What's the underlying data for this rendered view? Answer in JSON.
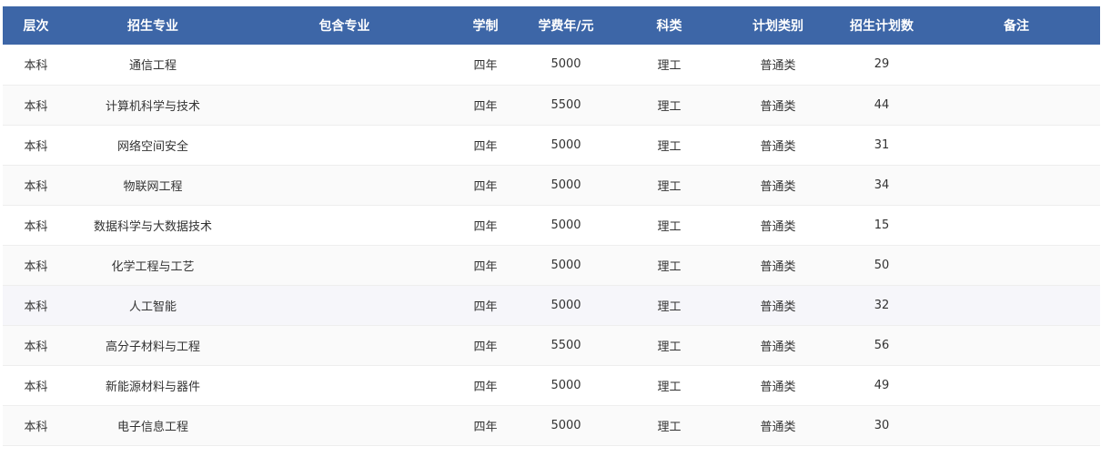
{
  "table": {
    "headers": {
      "level": "层次",
      "major": "招生专业",
      "include": "包含专业",
      "years": "学制",
      "fee": "学费年/元",
      "category": "科类",
      "plan_type": "计划类别",
      "count": "招生计划数",
      "note": "备注"
    },
    "header_color": "#3d66a7",
    "rows": [
      {
        "level": "本科",
        "major": "通信工程",
        "include": "",
        "years": "四年",
        "fee": "5000",
        "category": "理工",
        "plan_type": "普通类",
        "count": "29",
        "note": ""
      },
      {
        "level": "本科",
        "major": "计算机科学与技术",
        "include": "",
        "years": "四年",
        "fee": "5500",
        "category": "理工",
        "plan_type": "普通类",
        "count": "44",
        "note": ""
      },
      {
        "level": "本科",
        "major": "网络空间安全",
        "include": "",
        "years": "四年",
        "fee": "5000",
        "category": "理工",
        "plan_type": "普通类",
        "count": "31",
        "note": ""
      },
      {
        "level": "本科",
        "major": "物联网工程",
        "include": "",
        "years": "四年",
        "fee": "5000",
        "category": "理工",
        "plan_type": "普通类",
        "count": "34",
        "note": ""
      },
      {
        "level": "本科",
        "major": "数据科学与大数据技术",
        "include": "",
        "years": "四年",
        "fee": "5000",
        "category": "理工",
        "plan_type": "普通类",
        "count": "15",
        "note": ""
      },
      {
        "level": "本科",
        "major": "化学工程与工艺",
        "include": "",
        "years": "四年",
        "fee": "5000",
        "category": "理工",
        "plan_type": "普通类",
        "count": "50",
        "note": ""
      },
      {
        "level": "本科",
        "major": "人工智能",
        "include": "",
        "years": "四年",
        "fee": "5000",
        "category": "理工",
        "plan_type": "普通类",
        "count": "32",
        "note": ""
      },
      {
        "level": "本科",
        "major": "高分子材料与工程",
        "include": "",
        "years": "四年",
        "fee": "5500",
        "category": "理工",
        "plan_type": "普通类",
        "count": "56",
        "note": ""
      },
      {
        "level": "本科",
        "major": "新能源材料与器件",
        "include": "",
        "years": "四年",
        "fee": "5000",
        "category": "理工",
        "plan_type": "普通类",
        "count": "49",
        "note": ""
      },
      {
        "level": "本科",
        "major": "电子信息工程",
        "include": "",
        "years": "四年",
        "fee": "5000",
        "category": "理工",
        "plan_type": "普通类",
        "count": "30",
        "note": ""
      }
    ]
  }
}
